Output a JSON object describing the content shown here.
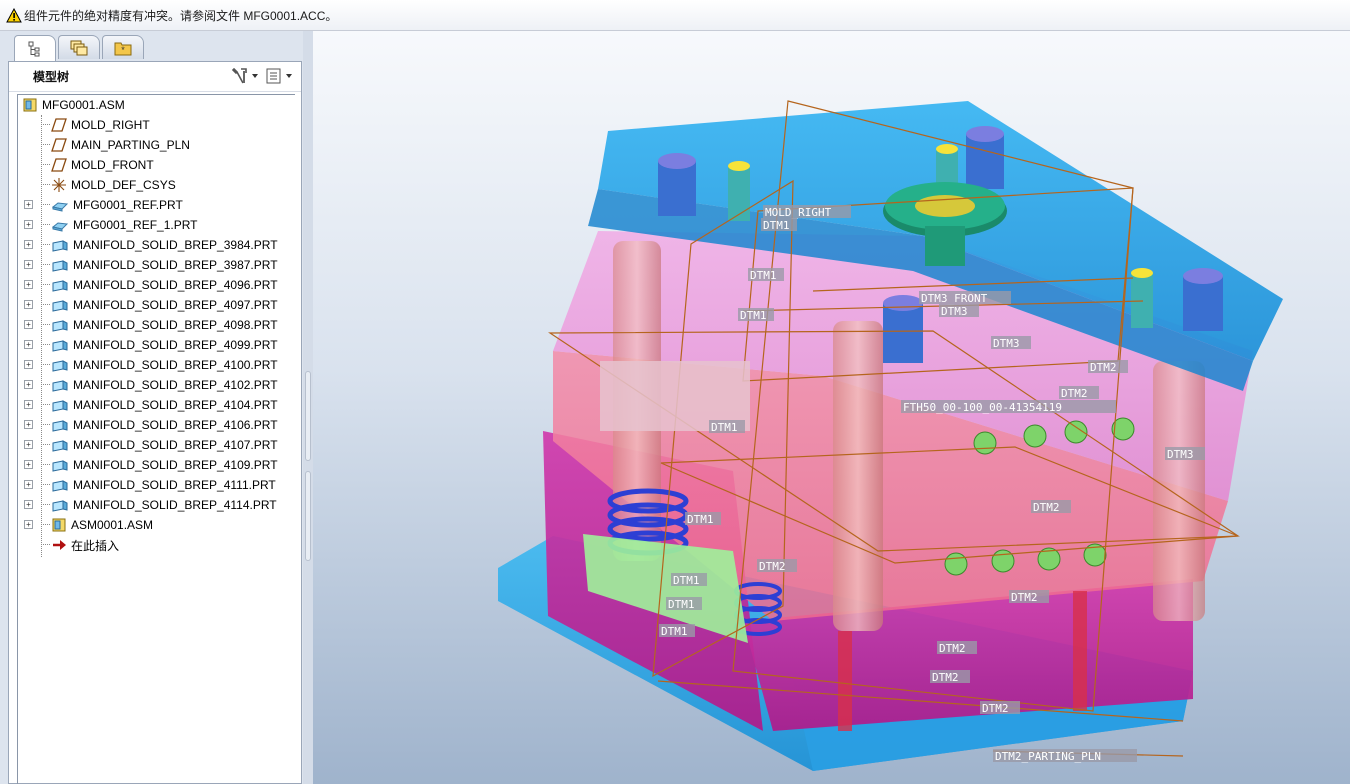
{
  "message_bar": {
    "text": "组件元件的绝对精度有冲突。请参阅文件 MFG0001.ACC。",
    "icon": "warning-icon"
  },
  "model_tree": {
    "title": "模型树",
    "tabs": [
      "model-tree-tab",
      "layers-tab",
      "folder-tab"
    ],
    "tools": [
      "settings-icon",
      "show-icon"
    ],
    "items": [
      {
        "label": "MFG0001.ASM",
        "icon": "assembly-icon",
        "expandable": false
      },
      {
        "label": "MOLD_RIGHT",
        "icon": "datum-plane-icon",
        "expandable": false
      },
      {
        "label": "MAIN_PARTING_PLN",
        "icon": "datum-plane-icon",
        "expandable": false
      },
      {
        "label": "MOLD_FRONT",
        "icon": "datum-plane-icon",
        "expandable": false
      },
      {
        "label": "MOLD_DEF_CSYS",
        "icon": "csys-icon",
        "expandable": false
      },
      {
        "label": "MFG0001_REF.PRT",
        "icon": "ref-part-icon",
        "expandable": true
      },
      {
        "label": "MFG0001_REF_1.PRT",
        "icon": "ref-part-icon",
        "expandable": true
      },
      {
        "label": "MANIFOLD_SOLID_BREP_3984.PRT",
        "icon": "part-icon",
        "expandable": true
      },
      {
        "label": "MANIFOLD_SOLID_BREP_3987.PRT",
        "icon": "part-icon",
        "expandable": true
      },
      {
        "label": "MANIFOLD_SOLID_BREP_4096.PRT",
        "icon": "part-icon",
        "expandable": true
      },
      {
        "label": "MANIFOLD_SOLID_BREP_4097.PRT",
        "icon": "part-icon",
        "expandable": true
      },
      {
        "label": "MANIFOLD_SOLID_BREP_4098.PRT",
        "icon": "part-icon",
        "expandable": true
      },
      {
        "label": "MANIFOLD_SOLID_BREP_4099.PRT",
        "icon": "part-icon",
        "expandable": true
      },
      {
        "label": "MANIFOLD_SOLID_BREP_4100.PRT",
        "icon": "part-icon",
        "expandable": true
      },
      {
        "label": "MANIFOLD_SOLID_BREP_4102.PRT",
        "icon": "part-icon",
        "expandable": true
      },
      {
        "label": "MANIFOLD_SOLID_BREP_4104.PRT",
        "icon": "part-icon",
        "expandable": true
      },
      {
        "label": "MANIFOLD_SOLID_BREP_4106.PRT",
        "icon": "part-icon",
        "expandable": true
      },
      {
        "label": "MANIFOLD_SOLID_BREP_4107.PRT",
        "icon": "part-icon",
        "expandable": true
      },
      {
        "label": "MANIFOLD_SOLID_BREP_4109.PRT",
        "icon": "part-icon",
        "expandable": true
      },
      {
        "label": "MANIFOLD_SOLID_BREP_4111.PRT",
        "icon": "part-icon",
        "expandable": true
      },
      {
        "label": "MANIFOLD_SOLID_BREP_4114.PRT",
        "icon": "part-icon",
        "expandable": true
      },
      {
        "label": "ASM0001.ASM",
        "icon": "assembly-icon",
        "expandable": true
      },
      {
        "label": "在此插入",
        "icon": "insert-here-arrow-icon",
        "expandable": false
      }
    ]
  },
  "viewport": {
    "datum_labels": {
      "mold_right": "MOLD_RIGHT",
      "dtm1": "DTM1",
      "dtm2": "DTM2",
      "dtm3": "DTM3",
      "dtm3_front": "DTM3_FRONT",
      "component": "FTH50_00-100_00-41354119",
      "parting": "DTM2_PARTING_PLN"
    },
    "colors": {
      "plate_blue": "#2aa7ea",
      "plate_pink": "#ee8fd6",
      "plate_red": "#f07aa0",
      "plate_magenta": "#c0249a",
      "datum_line": "#b5651d",
      "spring_blue": "#2d3fd4",
      "gate_green": "#1a8a6a"
    }
  }
}
